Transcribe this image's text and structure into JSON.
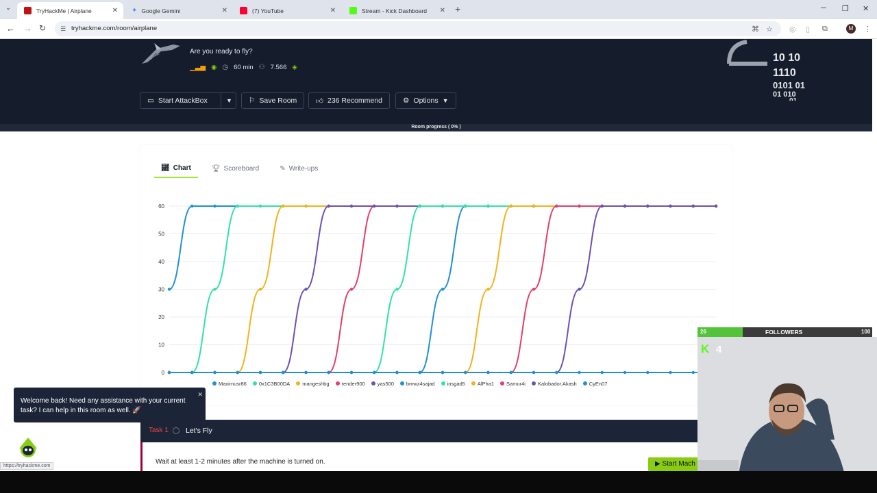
{
  "browser": {
    "tabs": [
      {
        "title": "TryHackMe | Airplane",
        "color": "#c11111"
      },
      {
        "title": "Google Gemini",
        "color": "#4b8df8"
      },
      {
        "title": "(7) YouTube",
        "color": "#ff0033"
      },
      {
        "title": "Stream - Kick Dashboard",
        "color": "#53fc18"
      }
    ],
    "url": "tryhackme.com/room/airplane",
    "profile_initial": "M"
  },
  "room": {
    "subtitle": "Are you ready to fly?",
    "duration": "60 min",
    "users": "7.566",
    "buttons": {
      "start": "Start AttackBox",
      "save": "Save Room",
      "recommend": "236 Recommend",
      "options": "Options"
    },
    "progress_label": "Room progress ( 0% )",
    "logo_bits": [
      "10  10",
      "1110",
      "0101  01",
      "01     010",
      "01"
    ]
  },
  "tabs": {
    "chart": "Chart",
    "scoreboard": "Scoreboard",
    "writeups": "Write-ups"
  },
  "chart_data": {
    "type": "line",
    "ylim": [
      0,
      60
    ],
    "yticks": [
      0,
      10,
      20,
      30,
      40,
      50,
      60
    ],
    "x_count": 25,
    "series": [
      {
        "name": "Maximusr86",
        "color": "#1e90d6",
        "values": [
          30,
          60,
          60,
          60,
          60,
          60,
          60,
          60,
          60,
          60,
          60,
          60,
          60,
          60,
          60,
          60,
          60,
          60,
          60,
          60,
          60,
          60,
          60,
          60,
          60
        ]
      },
      {
        "name": "0x1C3B00DA",
        "color": "#2fe3a0",
        "values": [
          0,
          0,
          30,
          60,
          60,
          60,
          60,
          60,
          60,
          60,
          60,
          60,
          60,
          60,
          60,
          60,
          60,
          60,
          60,
          60,
          60,
          60,
          60,
          60,
          60
        ]
      },
      {
        "name": "mangeshbg",
        "color": "#f2b21b",
        "values": [
          0,
          0,
          0,
          0,
          30,
          60,
          60,
          60,
          60,
          60,
          60,
          60,
          60,
          60,
          60,
          60,
          60,
          60,
          60,
          60,
          60,
          60,
          60,
          60,
          60
        ]
      },
      {
        "name": "render900",
        "color": "#e23f6b",
        "values": [
          0,
          0,
          0,
          0,
          0,
          0,
          0,
          0,
          30,
          60,
          60,
          60,
          60,
          60,
          60,
          60,
          60,
          60,
          60,
          60,
          60,
          60,
          60,
          60,
          60
        ]
      },
      {
        "name": "yas500",
        "color": "#6c4fb5",
        "values": [
          0,
          0,
          0,
          0,
          0,
          0,
          30,
          60,
          60,
          60,
          60,
          60,
          60,
          60,
          60,
          60,
          60,
          60,
          60,
          60,
          60,
          60,
          60,
          60,
          60
        ]
      },
      {
        "name": "bmwz4sajad",
        "color": "#1e90d6",
        "values": [
          0,
          0,
          0,
          0,
          0,
          0,
          0,
          0,
          0,
          0,
          0,
          0,
          30,
          60,
          60,
          60,
          60,
          60,
          60,
          60,
          60,
          60,
          60,
          60,
          60
        ]
      },
      {
        "name": "insgad5",
        "color": "#2fe3a0",
        "values": [
          0,
          0,
          0,
          0,
          0,
          0,
          0,
          0,
          0,
          0,
          30,
          60,
          60,
          60,
          60,
          60,
          60,
          60,
          60,
          60,
          60,
          60,
          60,
          60,
          60
        ]
      },
      {
        "name": "AlPha1",
        "color": "#f2b21b",
        "values": [
          0,
          0,
          0,
          0,
          0,
          0,
          0,
          0,
          0,
          0,
          0,
          0,
          0,
          0,
          30,
          60,
          60,
          60,
          60,
          60,
          60,
          60,
          60,
          60,
          60
        ]
      },
      {
        "name": "Samur4i",
        "color": "#e23f6b",
        "values": [
          0,
          0,
          0,
          0,
          0,
          0,
          0,
          0,
          0,
          0,
          0,
          0,
          0,
          0,
          0,
          0,
          30,
          60,
          60,
          60,
          60,
          60,
          60,
          60,
          60
        ]
      },
      {
        "name": "Kalobador.Akash",
        "color": "#6c4fb5",
        "values": [
          0,
          0,
          0,
          0,
          0,
          0,
          0,
          0,
          0,
          0,
          0,
          0,
          0,
          0,
          0,
          0,
          0,
          0,
          30,
          60,
          60,
          60,
          60,
          60,
          60
        ]
      },
      {
        "name": "CyEn07",
        "color": "#1e90d6",
        "values": [
          0,
          0,
          0,
          0,
          0,
          0,
          0,
          0,
          0,
          0,
          0,
          0,
          0,
          0,
          0,
          0,
          0,
          0,
          0,
          0,
          0,
          0,
          0,
          0,
          0
        ]
      }
    ]
  },
  "chat": {
    "message": "Welcome back! Need any assistance with your current task? I can help in this room as well. 🚀"
  },
  "task": {
    "number": "Task 1",
    "title": "Let's Fly",
    "text": "Wait at least 1-2 minutes after the machine is turned on.",
    "start_label": "Start Mach"
  },
  "overlay": {
    "current": "26",
    "label": "FOLLOWERS",
    "goal": "100",
    "followers_fill": 0.26,
    "viewers": "4"
  },
  "status_url": "https://tryhackme.com"
}
